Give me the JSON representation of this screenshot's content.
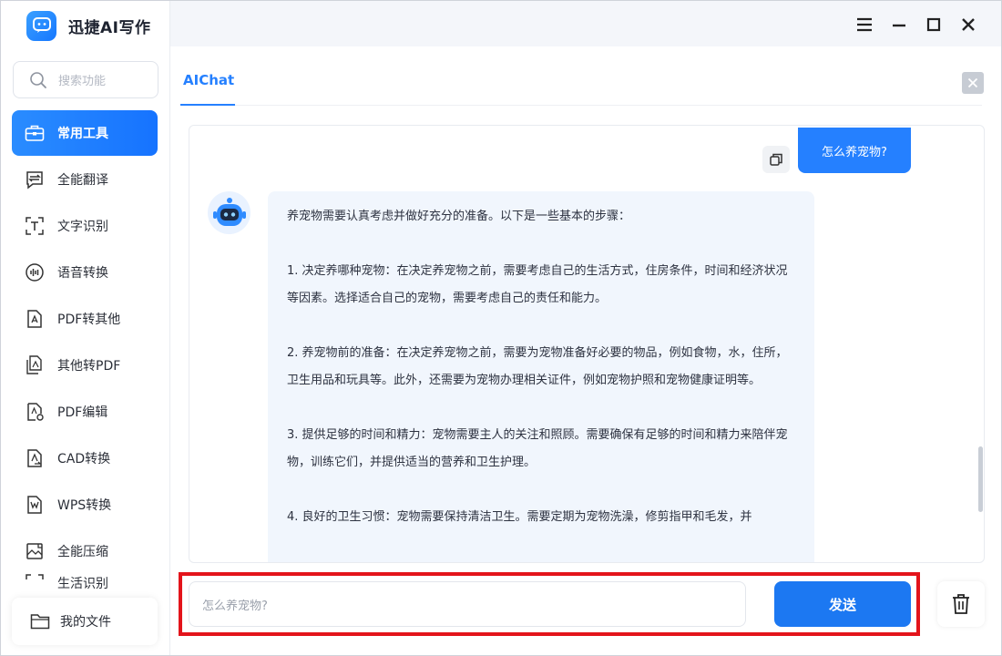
{
  "app": {
    "title": "迅捷AI写作"
  },
  "search": {
    "placeholder": "搜索功能"
  },
  "sidebar": {
    "items": [
      {
        "label": "常用工具",
        "icon": "toolbox-icon",
        "active": true
      },
      {
        "label": "全能翻译",
        "icon": "translate-icon"
      },
      {
        "label": "文字识别",
        "icon": "text-recognition-icon"
      },
      {
        "label": "语音转换",
        "icon": "voice-icon"
      },
      {
        "label": "PDF转其他",
        "icon": "pdf-convert-icon"
      },
      {
        "label": "其他转PDF",
        "icon": "to-pdf-icon"
      },
      {
        "label": "PDF编辑",
        "icon": "pdf-edit-icon"
      },
      {
        "label": "CAD转换",
        "icon": "cad-icon"
      },
      {
        "label": "WPS转换",
        "icon": "wps-icon"
      },
      {
        "label": "全能压缩",
        "icon": "compress-icon"
      },
      {
        "label": "生活识别",
        "icon": "scan-icon"
      }
    ],
    "my_files": "我的文件"
  },
  "tab": {
    "label": "AIChat"
  },
  "chat": {
    "user_message": "怎么养宠物?",
    "bot_paragraphs": [
      "养宠物需要认真考虑并做好充分的准备。以下是一些基本的步骤：",
      "1. 决定养哪种宠物：在决定养宠物之前，需要考虑自己的生活方式，住房条件，时间和经济状况等因素。选择适合自己的宠物，需要考虑自己的责任和能力。",
      "2. 养宠物前的准备：在决定养宠物之前，需要为宠物准备好必要的物品，例如食物，水，住所，卫生用品和玩具等。此外，还需要为宠物办理相关证件，例如宠物护照和宠物健康证明等。",
      "3. 提供足够的时间和精力：宠物需要主人的关注和照顾。需要确保有足够的时间和精力来陪伴宠物，训练它们，并提供适当的营养和卫生护理。",
      "4. 良好的卫生习惯：宠物需要保持清洁卫生。需要定期为宠物洗澡，修剪指甲和毛发，并"
    ]
  },
  "input": {
    "placeholder": "怎么养宠物?"
  },
  "send_label": "发送",
  "colors": {
    "accent": "#2580ff",
    "highlight": "#e3141b"
  }
}
